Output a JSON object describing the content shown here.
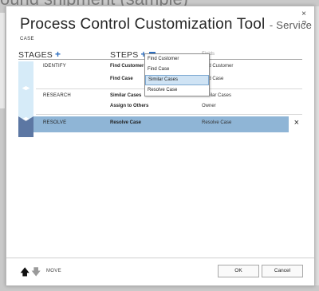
{
  "background": {
    "title": "ound shipment (sample)"
  },
  "dialog": {
    "close_glyph": "×",
    "help_glyph": "?",
    "title": "Process Control Customization Tool",
    "subtitle": "- Service",
    "entity": "CASE"
  },
  "headers": {
    "stages": "STAGES",
    "stages_add": "+",
    "steps": "STEPS",
    "steps_add": "+",
    "steps_remove": "-",
    "fields": "Fields"
  },
  "stages": [
    {
      "name": "IDENTIFY",
      "steps": [
        {
          "step": "Find Customer",
          "field": "Find Customer"
        },
        {
          "step": "Find Case",
          "field": "Find Case"
        }
      ]
    },
    {
      "name": "RESEARCH",
      "steps": [
        {
          "step": "Similar Cases",
          "field": "Similar Cases"
        },
        {
          "step": "Assign to Others",
          "field": "Owner"
        }
      ]
    },
    {
      "name": "RESOLVE",
      "steps": [
        {
          "step": "Resolve Case",
          "field": "Resolve Case"
        }
      ],
      "selected": true
    }
  ],
  "selected_row_delete": "×",
  "step_dropdown": {
    "options": [
      "Find Customer",
      "Find Case",
      "Similar Cases",
      "Resolve Case"
    ],
    "highlighted": "Similar Cases"
  },
  "footer": {
    "move_up_icon": "arrow-up-icon",
    "move_down_icon": "arrow-down-icon",
    "move_label": "MOVE",
    "ok": "OK",
    "cancel": "Cancel"
  },
  "colors": {
    "accent": "#2e6fc0",
    "selected_row": "#8fb5d6",
    "stage_chevron": "#d6ebf8",
    "stage_chevron_active": "#5c77a3"
  }
}
